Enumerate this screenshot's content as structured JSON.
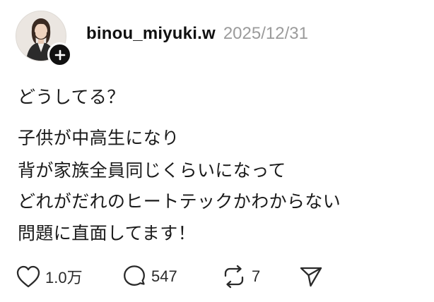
{
  "post": {
    "username": "binou_miyuki.w",
    "date": "2025/12/31",
    "avatar": "avatar-photo",
    "follow_icon": "plus-icon",
    "prompt": "どうしてる？",
    "body_lines": [
      "子供が中高生になり",
      "背が家族全員同じくらいになって",
      "どれがだれのヒートテックかわからない",
      "問題に直面してます！"
    ]
  },
  "actions": {
    "like": {
      "icon": "heart-icon",
      "count": "1.0万"
    },
    "reply": {
      "icon": "speech-bubble-icon",
      "count": "547"
    },
    "repost": {
      "icon": "repost-icon",
      "count": "7"
    },
    "share": {
      "icon": "send-icon"
    }
  },
  "colors": {
    "text": "#1a1a1a",
    "muted": "#9b9b9b",
    "follow_badge": "#111111"
  }
}
